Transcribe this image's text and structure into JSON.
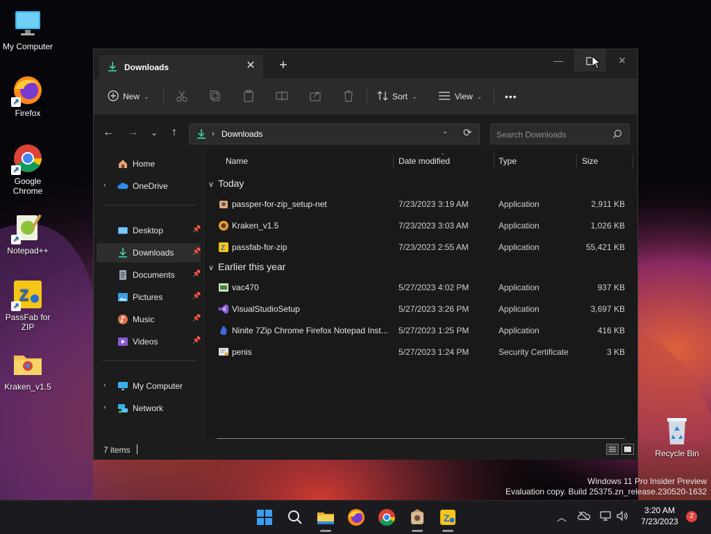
{
  "desktop": {
    "icons": [
      {
        "label": "My Computer"
      },
      {
        "label": "Firefox"
      },
      {
        "label": "Google Chrome"
      },
      {
        "label": "Notepad++"
      },
      {
        "label": "PassFab for ZIP"
      },
      {
        "label": "Kraken_v1.5"
      },
      {
        "label": "Recycle Bin"
      }
    ],
    "watermark": {
      "line1": "Windows 11 Pro Insider Preview",
      "line2": "Evaluation copy. Build 25375.zn_release.230520-1632"
    }
  },
  "window": {
    "tab_title": "Downloads",
    "toolbar": {
      "new_label": "New",
      "sort_label": "Sort",
      "view_label": "View",
      "more_label": "•••"
    },
    "address": {
      "location": "Downloads"
    },
    "search": {
      "placeholder": "Search Downloads"
    },
    "sidebar": {
      "items": [
        {
          "label": "Home"
        },
        {
          "label": "OneDrive"
        },
        {
          "label": "Desktop"
        },
        {
          "label": "Downloads"
        },
        {
          "label": "Documents"
        },
        {
          "label": "Pictures"
        },
        {
          "label": "Music"
        },
        {
          "label": "Videos"
        },
        {
          "label": "My Computer"
        },
        {
          "label": "Network"
        }
      ]
    },
    "columns": {
      "name": "Name",
      "date": "Date modified",
      "type": "Type",
      "size": "Size"
    },
    "groups": [
      {
        "label": "Today",
        "files": [
          {
            "name": "passper-for-zip_setup-net",
            "date": "7/23/2023 3:19 AM",
            "type": "Application",
            "size": "2,911 KB"
          },
          {
            "name": "Kraken_v1.5",
            "date": "7/23/2023 3:03 AM",
            "type": "Application",
            "size": "1,026 KB"
          },
          {
            "name": "passfab-for-zip",
            "date": "7/23/2023 2:55 AM",
            "type": "Application",
            "size": "55,421 KB"
          }
        ]
      },
      {
        "label": "Earlier this year",
        "files": [
          {
            "name": "vac470",
            "date": "5/27/2023 4:02 PM",
            "type": "Application",
            "size": "937 KB"
          },
          {
            "name": "VisualStudioSetup",
            "date": "5/27/2023 3:26 PM",
            "type": "Application",
            "size": "3,697 KB"
          },
          {
            "name": "Ninite 7Zip Chrome Firefox Notepad Inst...",
            "date": "5/27/2023 1:25 PM",
            "type": "Application",
            "size": "416 KB"
          },
          {
            "name": "penis",
            "date": "5/27/2023 1:24 PM",
            "type": "Security Certificate",
            "size": "3 KB"
          }
        ]
      }
    ],
    "status": {
      "item_count": "7 items"
    }
  },
  "taskbar": {
    "clock_time": "3:20 AM",
    "clock_date": "7/23/2023",
    "notification_count": "2"
  }
}
